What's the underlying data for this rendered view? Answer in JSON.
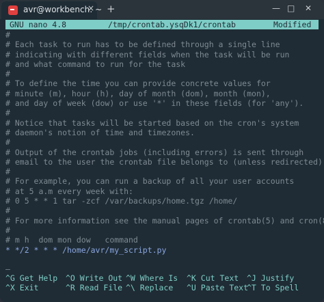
{
  "window": {
    "tab_title": "avr@workbench: ~",
    "tab_close": "×",
    "new_tab": "+",
    "min": "—",
    "max": "□",
    "close": "✕"
  },
  "nano": {
    "app": "GNU nano 4.8",
    "file": "/tmp/crontab.ysqDk1/crontab",
    "status": "Modified"
  },
  "lines": [
    {
      "t": "#",
      "type": "comment"
    },
    {
      "t": "# Each task to run has to be defined through a single line",
      "type": "comment"
    },
    {
      "t": "# indicating with different fields when the task will be run",
      "type": "comment"
    },
    {
      "t": "# and what command to run for the task",
      "type": "comment"
    },
    {
      "t": "#",
      "type": "comment"
    },
    {
      "t": "# To define the time you can provide concrete values for",
      "type": "comment"
    },
    {
      "t": "# minute (m), hour (h), day of month (dom), month (mon),",
      "type": "comment"
    },
    {
      "t": "# and day of week (dow) or use '*' in these fields (for 'any').",
      "type": "comment"
    },
    {
      "t": "#",
      "type": "comment"
    },
    {
      "t": "# Notice that tasks will be started based on the cron's system",
      "type": "comment"
    },
    {
      "t": "# daemon's notion of time and timezones.",
      "type": "comment"
    },
    {
      "t": "#",
      "type": "comment"
    },
    {
      "t": "# Output of the crontab jobs (including errors) is sent through",
      "type": "comment"
    },
    {
      "t": "# email to the user the crontab file belongs to (unless redirected).",
      "type": "comment"
    },
    {
      "t": "#",
      "type": "comment"
    },
    {
      "t": "# For example, you can run a backup of all your user accounts",
      "type": "comment"
    },
    {
      "t": "# at 5 a.m every week with:",
      "type": "comment"
    },
    {
      "t": "# 0 5 * * 1 tar -zcf /var/backups/home.tgz /home/",
      "type": "comment"
    },
    {
      "t": "#",
      "type": "comment"
    },
    {
      "t": "# For more information see the manual pages of crontab(5) and cron(8)",
      "type": "comment"
    },
    {
      "t": "#",
      "type": "comment"
    },
    {
      "t": "# m h  dom mon dow   command",
      "type": "comment"
    },
    {
      "t": "* */2 * * * /home/avr/my_script.py",
      "type": "code"
    },
    {
      "t": "",
      "type": "comment"
    },
    {
      "t": "—",
      "type": "cursor"
    }
  ],
  "shortcuts": [
    [
      {
        "key": "^G",
        "label": "Get Help"
      },
      {
        "key": "^O",
        "label": "Write Out"
      },
      {
        "key": "^W",
        "label": "Where Is"
      },
      {
        "key": "^K",
        "label": "Cut Text"
      },
      {
        "key": "^J",
        "label": "Justify"
      }
    ],
    [
      {
        "key": "^X",
        "label": "Exit"
      },
      {
        "key": "^R",
        "label": "Read File"
      },
      {
        "key": "^\\",
        "label": "Replace"
      },
      {
        "key": "^U",
        "label": "Paste Text"
      },
      {
        "key": "^T",
        "label": "To Spell"
      }
    ]
  ],
  "colors": {
    "background": "#1f2c35",
    "accent": "#7ecdc6",
    "comment": "#7f8a92",
    "code": "#8aa6e0"
  }
}
